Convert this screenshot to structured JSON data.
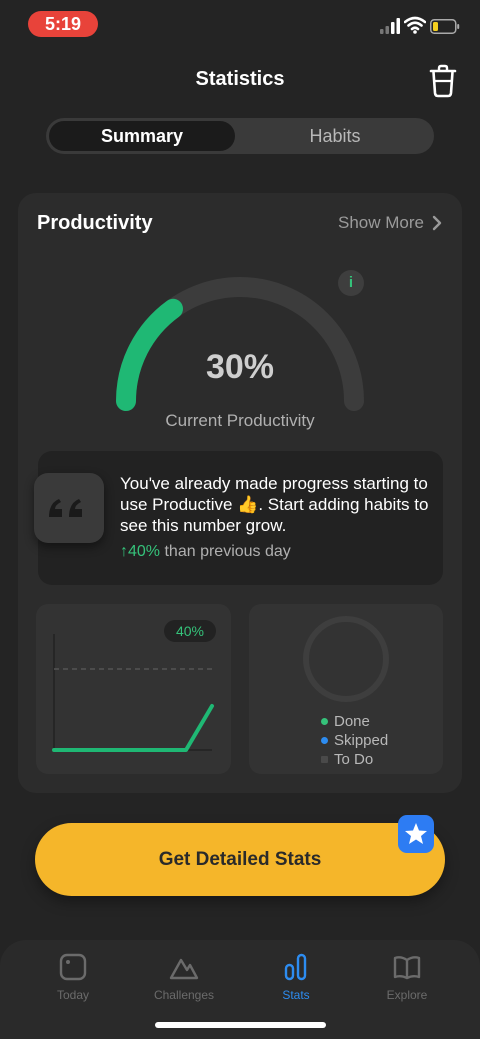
{
  "status_bar": {
    "time": "5:19"
  },
  "header": {
    "title": "Statistics"
  },
  "segmented": {
    "active": "Summary",
    "inactive": "Habits"
  },
  "productivity": {
    "title": "Productivity",
    "show_more": "Show More",
    "value": "30%",
    "gauge_fraction": 0.3,
    "label": "Current Productivity",
    "info_icon_text": "i"
  },
  "quote": {
    "text": "You've already made progress starting to use Productive 👍. Start adding habits to see this number grow.",
    "change": "↑40%",
    "change_suffix": " than previous day"
  },
  "mini_chart": {
    "badge": "40%"
  },
  "donut": {
    "legend": [
      {
        "label": "Done",
        "color": "#35c27a"
      },
      {
        "label": "Skipped",
        "color": "#2d8cf0"
      },
      {
        "label": "To Do",
        "color": "#4a4a4a"
      }
    ]
  },
  "cta": {
    "label": "Get Detailed Stats"
  },
  "tabs": [
    {
      "label": "Today",
      "icon": "today-icon"
    },
    {
      "label": "Challenges",
      "icon": "challenges-icon"
    },
    {
      "label": "Stats",
      "icon": "stats-icon"
    },
    {
      "label": "Explore",
      "icon": "explore-icon"
    }
  ],
  "colors": {
    "accent_green": "#35c27a",
    "accent_blue": "#2d8cf0",
    "cta_yellow": "#f5b62a",
    "background": "#242424"
  }
}
